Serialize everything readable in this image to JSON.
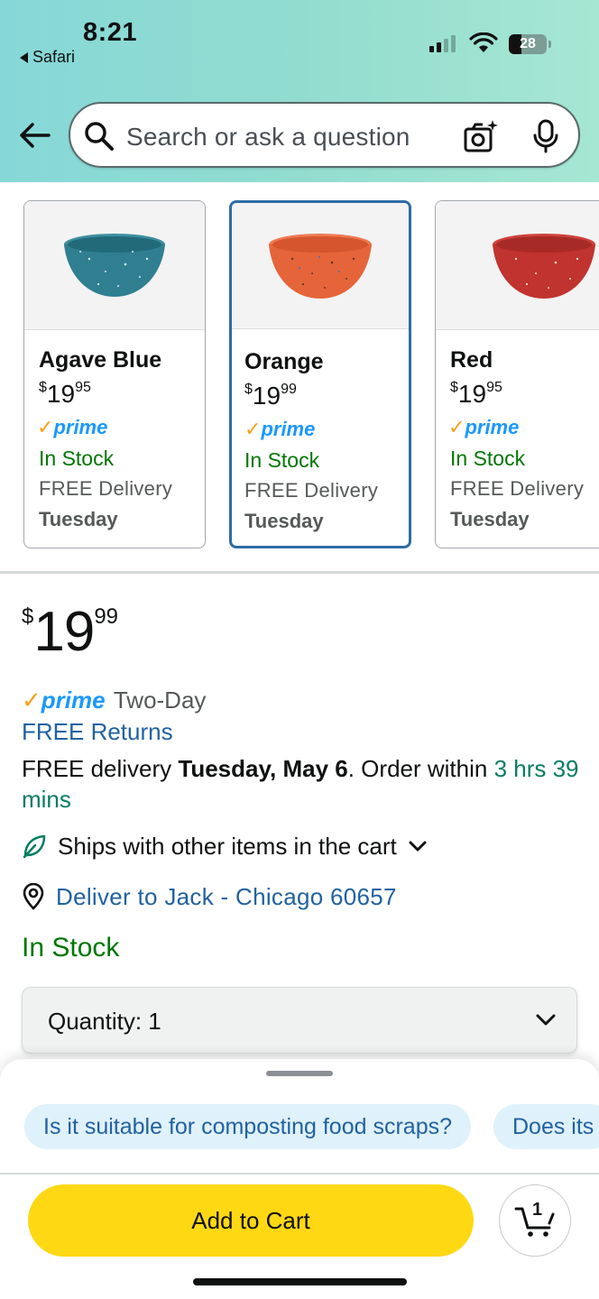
{
  "status_bar": {
    "time": "8:21",
    "back_app": "Safari",
    "battery": "28"
  },
  "header": {
    "search_placeholder": "Search or ask a question",
    "icons": [
      "back-arrow-icon",
      "search-icon",
      "camera-icon",
      "microphone-icon"
    ]
  },
  "variants": [
    {
      "name": "Agave Blue",
      "price_symbol": "$",
      "price_whole": "19",
      "price_cents": "95",
      "prime": "prime",
      "stock": "In Stock",
      "delivery": "FREE Delivery",
      "day": "Tuesday",
      "color": "#2f7f91",
      "selected": false
    },
    {
      "name": "Orange",
      "price_symbol": "$",
      "price_whole": "19",
      "price_cents": "99",
      "prime": "prime",
      "stock": "In Stock",
      "delivery": "FREE Delivery",
      "day": "Tuesday",
      "color": "#e5643a",
      "selected": true
    },
    {
      "name": "Red",
      "price_symbol": "$",
      "price_whole": "19",
      "price_cents": "95",
      "prime": "prime",
      "stock": "In Stock",
      "delivery": "FREE Delivery",
      "day": "Tuesday",
      "color": "#c0332e",
      "selected": false
    }
  ],
  "price": {
    "symbol": "$",
    "whole": "19",
    "cents": "99"
  },
  "prime_badge": {
    "word": "prime",
    "suffix": "Two-Day"
  },
  "free_returns": "FREE Returns",
  "delivery": {
    "prefix": "FREE delivery ",
    "date": "Tuesday, May 6",
    "middle": ". Order within ",
    "countdown": "3 hrs 39 mins"
  },
  "ships_with": "Ships with other items in the cart",
  "deliver_to": "Deliver to Jack - Chicago 60657",
  "in_stock": "In Stock",
  "quantity": {
    "label": "Quantity:",
    "value": "1"
  },
  "questions": [
    "Is it suitable for composting food scraps?",
    "Does its"
  ],
  "add_to_cart": "Add to Cart",
  "cart_count": "1",
  "colors": {
    "prime_blue": "#1a98ff",
    "prime_check": "#f7a11a",
    "link": "#2162a1",
    "stock_green": "#007600",
    "cart_yellow": "#ffd814",
    "selected_border": "#2e6ca4"
  }
}
